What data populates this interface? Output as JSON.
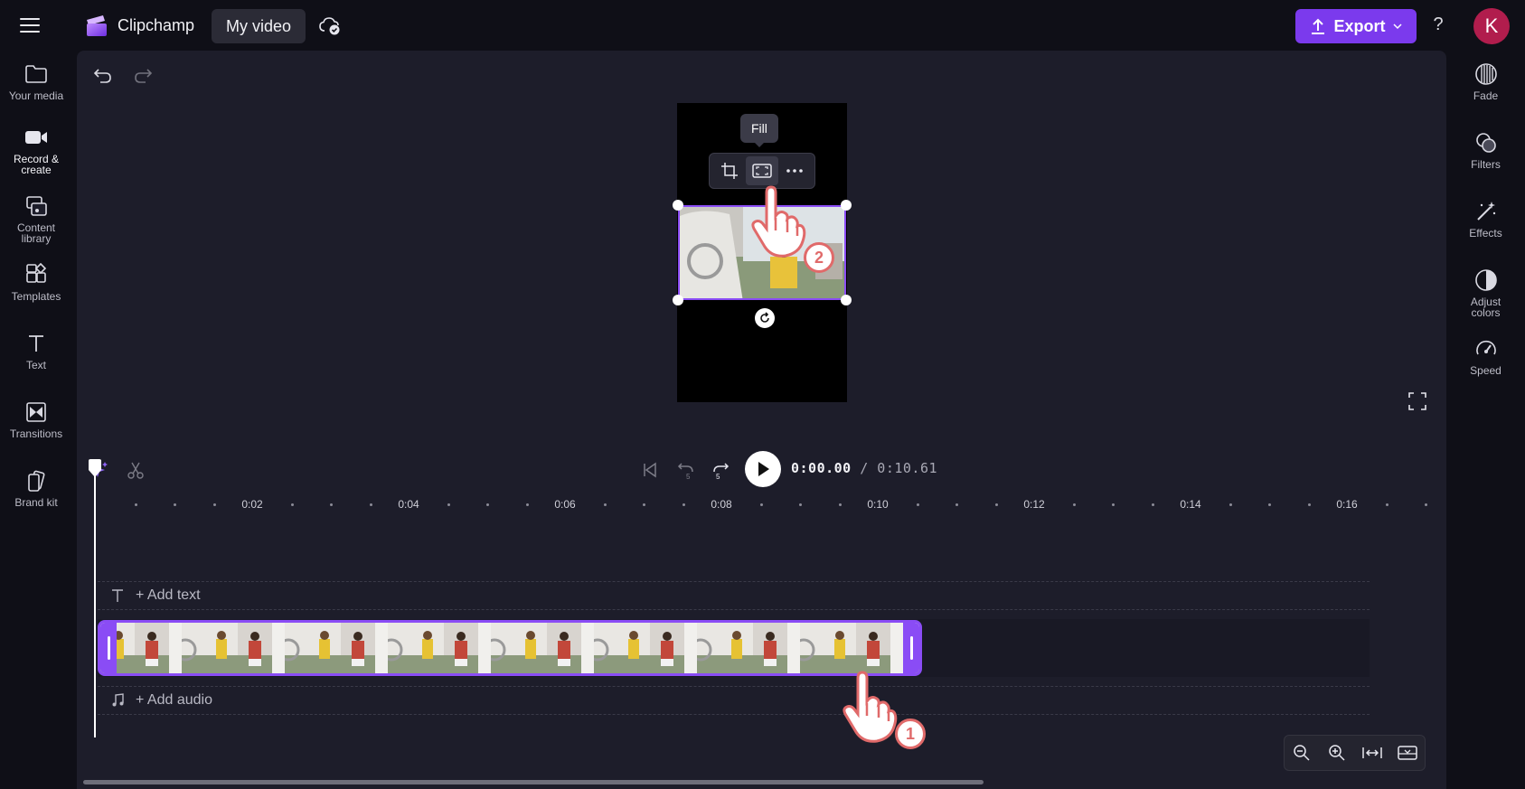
{
  "app": {
    "name": "Clipchamp",
    "project_title": "My video"
  },
  "header": {
    "export_label": "Export",
    "help_label": "?",
    "avatar_initial": "K",
    "accent_color": "#7b3aed"
  },
  "left_sidebar": {
    "items": [
      {
        "label": "Your media",
        "icon": "folder-icon"
      },
      {
        "label": "Record & create",
        "icon": "camera-icon"
      },
      {
        "label": "Content library",
        "icon": "library-icon"
      },
      {
        "label": "Templates",
        "icon": "templates-icon"
      },
      {
        "label": "Text",
        "icon": "text-icon"
      },
      {
        "label": "Transitions",
        "icon": "transitions-icon"
      },
      {
        "label": "Brand kit",
        "icon": "brand-kit-icon"
      }
    ]
  },
  "right_sidebar": {
    "items": [
      {
        "label": "Fade",
        "icon": "fade-icon"
      },
      {
        "label": "Filters",
        "icon": "filters-icon"
      },
      {
        "label": "Effects",
        "icon": "effects-icon"
      },
      {
        "label": "Adjust colors",
        "icon": "adjust-colors-icon"
      },
      {
        "label": "Speed",
        "icon": "speed-icon"
      }
    ]
  },
  "preview": {
    "tooltip": "Fill"
  },
  "playback": {
    "current_time": "0:00.00",
    "total_time": "/ 0:10.61",
    "skip_seconds": "5"
  },
  "timeline": {
    "ruler_labels": [
      "0:02",
      "0:04",
      "0:06",
      "0:08",
      "0:10",
      "0:12",
      "0:14",
      "0:16"
    ],
    "add_text_label": "+ Add text",
    "add_audio_label": "+ Add audio"
  },
  "annotations": {
    "step1": "1",
    "step2": "2"
  }
}
